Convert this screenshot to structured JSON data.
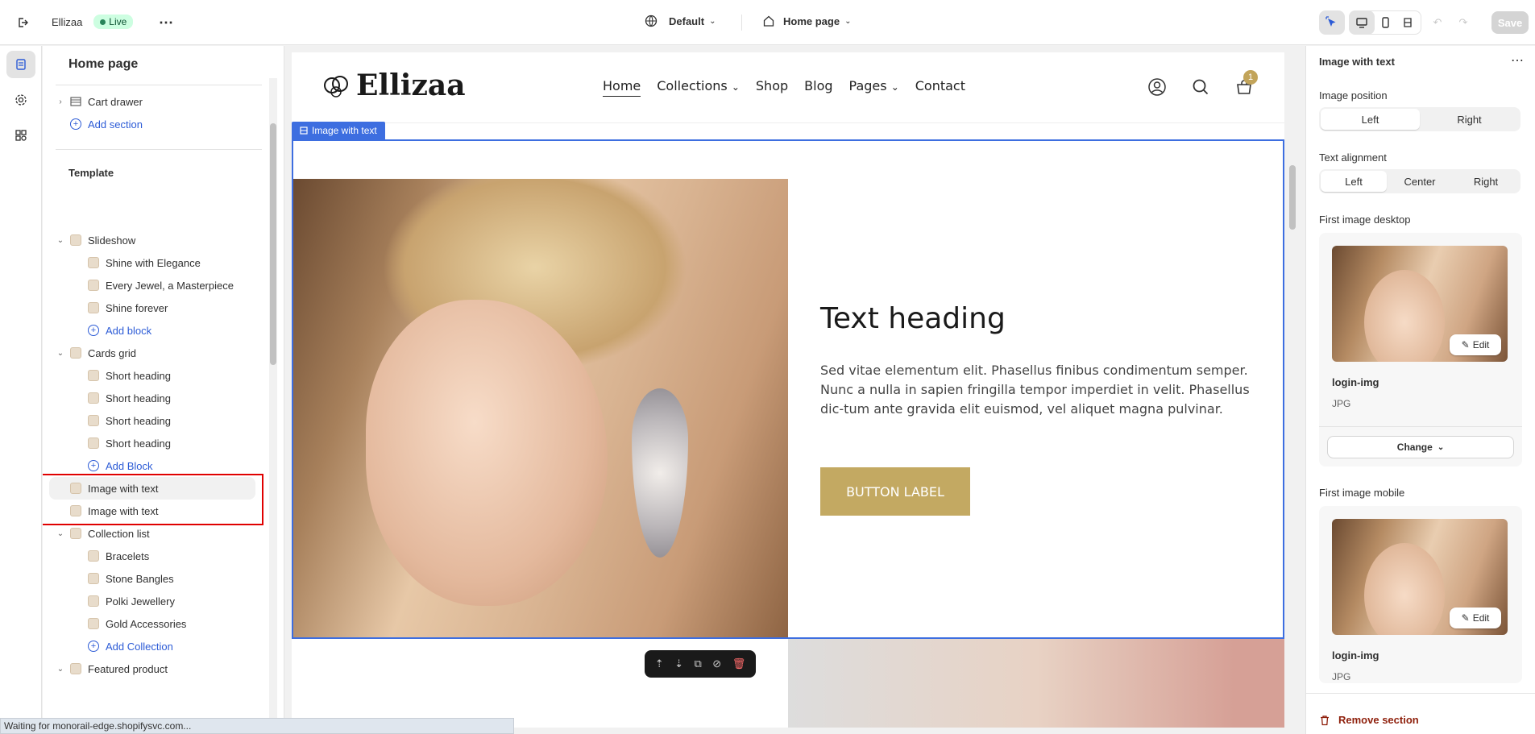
{
  "topbar": {
    "store_name": "Ellizaa",
    "status": "Live",
    "theme_selector": "Default",
    "page_selector": "Home page",
    "save_label": "Save"
  },
  "sidebar": {
    "title": "Home page",
    "header_items": [
      {
        "label": "Cart drawer"
      },
      {
        "label": "Add section"
      }
    ],
    "template_label": "Template",
    "tree": [
      {
        "label": "Slideshow",
        "kind": "section"
      },
      {
        "label": "Shine with Elegance",
        "kind": "block"
      },
      {
        "label": "Every Jewel, a Masterpiece",
        "kind": "block"
      },
      {
        "label": "Shine forever",
        "kind": "block"
      },
      {
        "label": "Add block",
        "kind": "add"
      },
      {
        "label": "Cards grid",
        "kind": "section"
      },
      {
        "label": "Short heading",
        "kind": "block"
      },
      {
        "label": "Short heading",
        "kind": "block"
      },
      {
        "label": "Short heading",
        "kind": "block"
      },
      {
        "label": "Short heading",
        "kind": "block"
      },
      {
        "label": "Add Block",
        "kind": "add"
      },
      {
        "label": "Image with text",
        "kind": "section"
      },
      {
        "label": "Image with text",
        "kind": "section"
      },
      {
        "label": "Collection list",
        "kind": "section"
      },
      {
        "label": "Bracelets",
        "kind": "block"
      },
      {
        "label": "Stone Bangles",
        "kind": "block"
      },
      {
        "label": "Polki Jewellery",
        "kind": "block"
      },
      {
        "label": "Gold Accessories",
        "kind": "block"
      },
      {
        "label": "Add Collection",
        "kind": "add"
      },
      {
        "label": "Featured product",
        "kind": "section"
      }
    ]
  },
  "preview": {
    "logo": "Ellizaa",
    "nav": [
      "Home",
      "Collections",
      "Shop",
      "Blog",
      "Pages",
      "Contact"
    ],
    "cart_count": "1",
    "section_tag": "Image with text",
    "heading": "Text heading",
    "body": "Sed vitae elementum elit. Phasellus finibus condimentum semper. Nunc a nulla in sapien fringilla tempor imperdiet in velit. Phasellus dic-tum ante gravida elit euismod, vel aliquet magna pulvinar.",
    "button": "BUTTON LABEL"
  },
  "inspector": {
    "title": "Image with text",
    "image_position_label": "Image position",
    "image_position_options": [
      "Left",
      "Right"
    ],
    "image_position_selected": "Left",
    "text_alignment_label": "Text alignment",
    "text_alignment_options": [
      "Left",
      "Center",
      "Right"
    ],
    "text_alignment_selected": "Left",
    "first_desktop_label": "First image desktop",
    "first_mobile_label": "First image mobile",
    "image_name": "login-img",
    "image_type": "JPG",
    "edit_label": "Edit",
    "change_label": "Change",
    "remove_label": "Remove section"
  },
  "status_bar": "Waiting for monorail-edge.shopifysvc.com...",
  "colors": {
    "accent": "#3d6ee0",
    "brand_gold": "#c3a962",
    "danger": "#8e1f0b",
    "live": "#29845a"
  }
}
